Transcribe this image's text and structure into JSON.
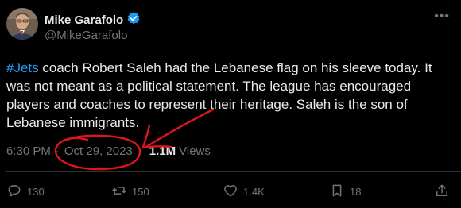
{
  "author": {
    "display_name": "Mike Garafolo",
    "handle": "@MikeGarafolo",
    "verified": true
  },
  "tweet": {
    "hashtag": "#Jets",
    "text": " coach Robert Saleh had the Lebanese flag on his sleeve today. It was not meant as a political statement. The league has encouraged players and coaches to represent their heritage. Saleh is the son of Lebanese immigrants."
  },
  "meta": {
    "time": "6:30 PM",
    "separator": "·",
    "date": "Oct 29, 2023",
    "views_count": "1.1M",
    "views_label": "Views"
  },
  "actions": {
    "replies": "130",
    "reposts": "150",
    "likes": "1.4K",
    "bookmarks": "18"
  },
  "colors": {
    "background": "#000000",
    "text": "#e7e9ea",
    "muted": "#71767b",
    "accent": "#1d9bf0",
    "annotation": "#e0141e"
  },
  "icons": {
    "more": "more-icon",
    "verified": "verified-badge-icon",
    "reply": "reply-icon",
    "repost": "repost-icon",
    "like": "like-icon",
    "bookmark": "bookmark-icon",
    "share": "share-icon"
  }
}
